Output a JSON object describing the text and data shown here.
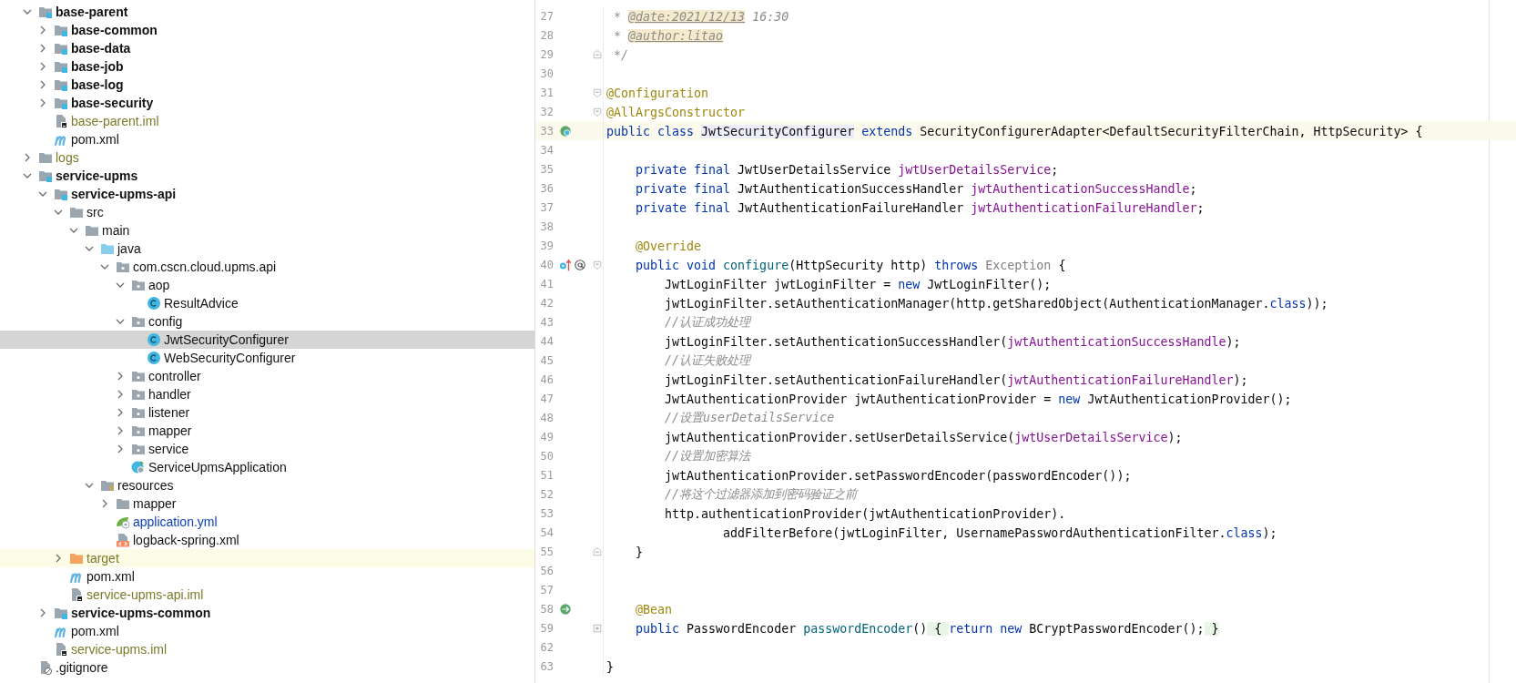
{
  "project_tree": {
    "items": [
      {
        "label": "base-parent",
        "kind": "module",
        "ignored": false,
        "modified": false,
        "selected": false,
        "highlighted": false,
        "expanded": true,
        "children": [
          {
            "label": "base-common",
            "kind": "module",
            "ignored": false,
            "modified": false,
            "selected": false,
            "highlighted": false,
            "expanded": false
          },
          {
            "label": "base-data",
            "kind": "module",
            "ignored": false,
            "modified": false,
            "selected": false,
            "highlighted": false,
            "expanded": false
          },
          {
            "label": "base-job",
            "kind": "module",
            "ignored": false,
            "modified": false,
            "selected": false,
            "highlighted": false,
            "expanded": false
          },
          {
            "label": "base-log",
            "kind": "module",
            "ignored": false,
            "modified": false,
            "selected": false,
            "highlighted": false,
            "expanded": false
          },
          {
            "label": "base-security",
            "kind": "module",
            "ignored": false,
            "modified": false,
            "selected": false,
            "highlighted": false,
            "expanded": false
          },
          {
            "label": "base-parent.iml",
            "kind": "iml",
            "ignored": true,
            "modified": false,
            "selected": false,
            "highlighted": false
          },
          {
            "label": "pom.xml",
            "kind": "maven",
            "ignored": false,
            "modified": false,
            "selected": false,
            "highlighted": false
          }
        ]
      },
      {
        "label": "logs",
        "kind": "folder",
        "ignored": true,
        "modified": false,
        "selected": false,
        "highlighted": false,
        "expanded": false
      },
      {
        "label": "service-upms",
        "kind": "module",
        "ignored": false,
        "modified": false,
        "selected": false,
        "highlighted": false,
        "expanded": true,
        "children": [
          {
            "label": "service-upms-api",
            "kind": "module",
            "ignored": false,
            "modified": false,
            "selected": false,
            "highlighted": false,
            "expanded": true,
            "children": [
              {
                "label": "src",
                "kind": "folder",
                "ignored": false,
                "modified": false,
                "selected": false,
                "highlighted": false,
                "expanded": true,
                "children": [
                  {
                    "label": "main",
                    "kind": "folder",
                    "ignored": false,
                    "modified": false,
                    "selected": false,
                    "highlighted": false,
                    "expanded": true,
                    "children": [
                      {
                        "label": "java",
                        "kind": "source-root",
                        "ignored": false,
                        "modified": false,
                        "selected": false,
                        "highlighted": false,
                        "expanded": true,
                        "children": [
                          {
                            "label": "com.cscn.cloud.upms.api",
                            "kind": "package",
                            "ignored": false,
                            "modified": false,
                            "selected": false,
                            "highlighted": false,
                            "expanded": true,
                            "children": [
                              {
                                "label": "aop",
                                "kind": "package",
                                "ignored": false,
                                "modified": false,
                                "selected": false,
                                "highlighted": false,
                                "expanded": true,
                                "children": [
                                  {
                                    "label": "ResultAdvice",
                                    "kind": "class",
                                    "ignored": false,
                                    "modified": false,
                                    "selected": false,
                                    "highlighted": false
                                  }
                                ]
                              },
                              {
                                "label": "config",
                                "kind": "package",
                                "ignored": false,
                                "modified": false,
                                "selected": false,
                                "highlighted": false,
                                "expanded": true,
                                "children": [
                                  {
                                    "label": "JwtSecurityConfigurer",
                                    "kind": "class",
                                    "ignored": false,
                                    "modified": false,
                                    "selected": true,
                                    "highlighted": false
                                  },
                                  {
                                    "label": "WebSecurityConfigurer",
                                    "kind": "class",
                                    "ignored": false,
                                    "modified": false,
                                    "selected": false,
                                    "highlighted": false
                                  }
                                ]
                              },
                              {
                                "label": "controller",
                                "kind": "package",
                                "ignored": false,
                                "modified": false,
                                "selected": false,
                                "highlighted": false,
                                "expanded": false
                              },
                              {
                                "label": "handler",
                                "kind": "package",
                                "ignored": false,
                                "modified": false,
                                "selected": false,
                                "highlighted": false,
                                "expanded": false
                              },
                              {
                                "label": "listener",
                                "kind": "package",
                                "ignored": false,
                                "modified": false,
                                "selected": false,
                                "highlighted": false,
                                "expanded": false
                              },
                              {
                                "label": "mapper",
                                "kind": "package",
                                "ignored": false,
                                "modified": false,
                                "selected": false,
                                "highlighted": false,
                                "expanded": false
                              },
                              {
                                "label": "service",
                                "kind": "package",
                                "ignored": false,
                                "modified": false,
                                "selected": false,
                                "highlighted": false,
                                "expanded": false
                              },
                              {
                                "label": "ServiceUpmsApplication",
                                "kind": "app-class",
                                "ignored": false,
                                "modified": false,
                                "selected": false,
                                "highlighted": false
                              }
                            ]
                          }
                        ]
                      },
                      {
                        "label": "resources",
                        "kind": "resources-root",
                        "ignored": false,
                        "modified": false,
                        "selected": false,
                        "highlighted": false,
                        "expanded": true,
                        "children": [
                          {
                            "label": "mapper",
                            "kind": "folder",
                            "ignored": false,
                            "modified": false,
                            "selected": false,
                            "highlighted": false,
                            "expanded": false
                          },
                          {
                            "label": "application.yml",
                            "kind": "config-file",
                            "ignored": false,
                            "modified": true,
                            "selected": false,
                            "highlighted": false
                          },
                          {
                            "label": "logback-spring.xml",
                            "kind": "xml",
                            "ignored": false,
                            "modified": false,
                            "selected": false,
                            "highlighted": false
                          }
                        ]
                      }
                    ]
                  }
                ]
              },
              {
                "label": "target",
                "kind": "excluded-folder",
                "ignored": true,
                "modified": false,
                "selected": false,
                "highlighted": true,
                "expanded": false
              },
              {
                "label": "pom.xml",
                "kind": "maven",
                "ignored": false,
                "modified": false,
                "selected": false,
                "highlighted": false
              },
              {
                "label": "service-upms-api.iml",
                "kind": "iml",
                "ignored": true,
                "modified": false,
                "selected": false,
                "highlighted": false
              }
            ]
          },
          {
            "label": "service-upms-common",
            "kind": "module",
            "ignored": false,
            "modified": false,
            "selected": false,
            "highlighted": false,
            "expanded": false
          },
          {
            "label": "pom.xml",
            "kind": "maven",
            "ignored": false,
            "modified": false,
            "selected": false,
            "highlighted": false
          },
          {
            "label": "service-upms.iml",
            "kind": "iml",
            "ignored": true,
            "modified": false,
            "selected": false,
            "highlighted": false
          }
        ]
      },
      {
        "label": ".gitignore",
        "kind": "gitignore",
        "ignored": false,
        "modified": false,
        "selected": false,
        "highlighted": false
      }
    ]
  },
  "editor": {
    "lines": [
      {
        "number": "27",
        "current": false,
        "tokens": [
          {
            "kind": "comment",
            "text": " * "
          },
          {
            "kind": "doc-tag",
            "text": "@date:2021/12/13"
          },
          {
            "kind": "comment",
            "text": " 16:30"
          }
        ]
      },
      {
        "number": "28",
        "current": false,
        "tokens": [
          {
            "kind": "comment",
            "text": " * "
          },
          {
            "kind": "doc-tag",
            "text": "@author:litao"
          }
        ]
      },
      {
        "number": "29",
        "current": false,
        "fold": {
          "kind": "end"
        },
        "tokens": [
          {
            "kind": "comment",
            "text": " */"
          }
        ]
      },
      {
        "number": "30",
        "current": false
      },
      {
        "number": "31",
        "current": false,
        "fold": {
          "kind": "start"
        },
        "tokens": [
          {
            "kind": "annotation",
            "text": "@Configuration"
          }
        ]
      },
      {
        "number": "32",
        "current": false,
        "fold": {
          "kind": "start"
        },
        "tokens": [
          {
            "kind": "annotation",
            "text": "@AllArgsConstructor"
          }
        ]
      },
      {
        "number": "33",
        "current": true,
        "markers": [
          {
            "kind": "implemented"
          }
        ],
        "tokens": [
          {
            "kind": "keyword",
            "text": "public class "
          },
          {
            "kind": "declaration",
            "text": "JwtSecurityConfigurer"
          },
          {
            "kind": "keyword",
            "text": " extends"
          },
          {
            "kind": "plain",
            "text": " SecurityConfigurerAdapter<DefaultSecurityFilterChain, HttpSecurity> {"
          }
        ]
      },
      {
        "number": "34",
        "current": false
      },
      {
        "number": "35",
        "current": false,
        "tokens": [
          {
            "kind": "keyword",
            "text": "    private final "
          },
          {
            "kind": "plain",
            "text": "JwtUserDetailsService "
          },
          {
            "kind": "field",
            "text": "jwtUserDetailsService"
          },
          {
            "kind": "plain",
            "text": ";"
          }
        ]
      },
      {
        "number": "36",
        "current": false,
        "tokens": [
          {
            "kind": "keyword",
            "text": "    private final "
          },
          {
            "kind": "plain",
            "text": "JwtAuthenticationSuccessHandler "
          },
          {
            "kind": "field",
            "text": "jwtAuthenticationSuccessHandle"
          },
          {
            "kind": "plain",
            "text": ";"
          }
        ]
      },
      {
        "number": "37",
        "current": false,
        "tokens": [
          {
            "kind": "keyword",
            "text": "    private final "
          },
          {
            "kind": "plain",
            "text": "JwtAuthenticationFailureHandler "
          },
          {
            "kind": "field",
            "text": "jwtAuthenticationFailureHandler"
          },
          {
            "kind": "plain",
            "text": ";"
          }
        ]
      },
      {
        "number": "38",
        "current": false
      },
      {
        "number": "39",
        "current": false,
        "tokens": [
          {
            "kind": "annotation",
            "text": "    @Override"
          }
        ]
      },
      {
        "number": "40",
        "current": false,
        "fold": {
          "kind": "start"
        },
        "markers": [
          {
            "kind": "override"
          },
          {
            "kind": "bean-link"
          }
        ],
        "tokens": [
          {
            "kind": "keyword",
            "text": "    public void "
          },
          {
            "kind": "method",
            "text": "configure"
          },
          {
            "kind": "plain",
            "text": "(HttpSecurity http) "
          },
          {
            "kind": "keyword",
            "text": "throws "
          },
          {
            "kind": "unused",
            "text": "Exception"
          },
          {
            "kind": "plain",
            "text": " {"
          }
        ]
      },
      {
        "number": "41",
        "current": false,
        "tokens": [
          {
            "kind": "plain",
            "text": "        JwtLoginFilter jwtLoginFilter = "
          },
          {
            "kind": "keyword",
            "text": "new"
          },
          {
            "kind": "plain",
            "text": " JwtLoginFilter();"
          }
        ]
      },
      {
        "number": "42",
        "current": false,
        "tokens": [
          {
            "kind": "plain",
            "text": "        jwtLoginFilter.setAuthenticationManager(http.getSharedObject(AuthenticationManager."
          },
          {
            "kind": "keyword",
            "text": "class"
          },
          {
            "kind": "plain",
            "text": "));"
          }
        ]
      },
      {
        "number": "43",
        "current": false,
        "tokens": [
          {
            "kind": "comment",
            "text": "        //认证成功处理"
          }
        ]
      },
      {
        "number": "44",
        "current": false,
        "tokens": [
          {
            "kind": "plain",
            "text": "        jwtLoginFilter.setAuthenticationSuccessHandler("
          },
          {
            "kind": "field",
            "text": "jwtAuthenticationSuccessHandle"
          },
          {
            "kind": "plain",
            "text": ");"
          }
        ]
      },
      {
        "number": "45",
        "current": false,
        "tokens": [
          {
            "kind": "comment",
            "text": "        //认证失败处理"
          }
        ]
      },
      {
        "number": "46",
        "current": false,
        "tokens": [
          {
            "kind": "plain",
            "text": "        jwtLoginFilter.setAuthenticationFailureHandler("
          },
          {
            "kind": "field",
            "text": "jwtAuthenticationFailureHandler"
          },
          {
            "kind": "plain",
            "text": ");"
          }
        ]
      },
      {
        "number": "47",
        "current": false,
        "tokens": [
          {
            "kind": "plain",
            "text": "        JwtAuthenticationProvider jwtAuthenticationProvider = "
          },
          {
            "kind": "keyword",
            "text": "new"
          },
          {
            "kind": "plain",
            "text": " JwtAuthenticationProvider();"
          }
        ]
      },
      {
        "number": "48",
        "current": false,
        "tokens": [
          {
            "kind": "comment",
            "text": "        //设置userDetailsService"
          }
        ]
      },
      {
        "number": "49",
        "current": false,
        "tokens": [
          {
            "kind": "plain",
            "text": "        jwtAuthenticationProvider.setUserDetailsService("
          },
          {
            "kind": "field",
            "text": "jwtUserDetailsService"
          },
          {
            "kind": "plain",
            "text": ");"
          }
        ]
      },
      {
        "number": "50",
        "current": false,
        "tokens": [
          {
            "kind": "comment",
            "text": "        //设置加密算法"
          }
        ]
      },
      {
        "number": "51",
        "current": false,
        "tokens": [
          {
            "kind": "plain",
            "text": "        jwtAuthenticationProvider.setPasswordEncoder(passwordEncoder());"
          }
        ]
      },
      {
        "number": "52",
        "current": false,
        "tokens": [
          {
            "kind": "comment",
            "text": "        //将这个过滤器添加到密码验证之前"
          }
        ]
      },
      {
        "number": "53",
        "current": false,
        "tokens": [
          {
            "kind": "plain",
            "text": "        http.authenticationProvider(jwtAuthenticationProvider)."
          }
        ]
      },
      {
        "number": "54",
        "current": false,
        "tokens": [
          {
            "kind": "plain",
            "text": "                addFilterBefore(jwtLoginFilter, UsernamePasswordAuthenticationFilter."
          },
          {
            "kind": "keyword",
            "text": "class"
          },
          {
            "kind": "plain",
            "text": ");"
          }
        ]
      },
      {
        "number": "55",
        "current": false,
        "fold": {
          "kind": "end"
        },
        "tokens": [
          {
            "kind": "plain",
            "text": "    }"
          }
        ]
      },
      {
        "number": "56",
        "current": false
      },
      {
        "number": "57",
        "current": false
      },
      {
        "number": "58",
        "current": false,
        "markers": [
          {
            "kind": "bean"
          }
        ],
        "tokens": [
          {
            "kind": "annotation",
            "text": "    @Bean"
          }
        ]
      },
      {
        "number": "59",
        "current": false,
        "fold": {
          "kind": "collapsed"
        },
        "tokens": [
          {
            "kind": "keyword",
            "text": "    public "
          },
          {
            "kind": "plain",
            "text": "PasswordEncoder "
          },
          {
            "kind": "method",
            "text": "passwordEncoder"
          },
          {
            "kind": "plain",
            "text": "()"
          },
          {
            "kind": "folded",
            "text": " { "
          },
          {
            "kind": "keyword",
            "text": "return new "
          },
          {
            "kind": "plain",
            "text": "BCryptPasswordEncoder();"
          },
          {
            "kind": "folded",
            "text": " }"
          }
        ]
      },
      {
        "number": "62",
        "current": false
      },
      {
        "number": "63",
        "current": false,
        "tokens": [
          {
            "kind": "plain",
            "text": "}"
          }
        ]
      }
    ]
  }
}
